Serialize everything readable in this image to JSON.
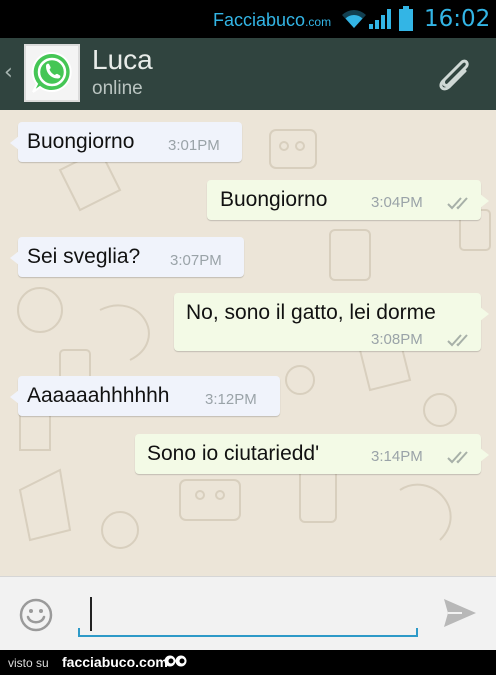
{
  "status_bar": {
    "brand": "Facciabuco",
    "brand_suffix": ".com",
    "time": "16:02",
    "icons": [
      "wifi-icon",
      "signal-icon",
      "battery-icon"
    ],
    "accent_color": "#33b5e5"
  },
  "header": {
    "back_icon": "chevron-left-icon",
    "avatar_icon": "whatsapp-icon",
    "contact_name": "Luca",
    "presence": "online",
    "attach_icon": "paperclip-icon",
    "background_color": "#30443f"
  },
  "messages": [
    {
      "direction": "incoming",
      "text": "Buongiorno",
      "time": "3:01PM"
    },
    {
      "direction": "outgoing",
      "text": "Buongiorno",
      "time": "3:04PM",
      "status": "read"
    },
    {
      "direction": "incoming",
      "text": "Sei sveglia?",
      "time": "3:07PM"
    },
    {
      "direction": "outgoing",
      "text": "No, sono il gatto, lei dorme",
      "time": "3:08PM",
      "status": "read"
    },
    {
      "direction": "incoming",
      "text": "Aaaaaahhhhhh",
      "time": "3:12PM"
    },
    {
      "direction": "outgoing",
      "text": "Sono io ciutariedd'",
      "time": "3:14PM",
      "status": "read"
    }
  ],
  "composer": {
    "emoji_icon": "smiley-icon",
    "input_value": "",
    "send_icon": "send-icon",
    "accent_color": "#2e9ac8"
  },
  "footer": {
    "visto_su": "visto su",
    "site": "facciabuco.com",
    "logo_icon": "eyes-logo-icon"
  }
}
